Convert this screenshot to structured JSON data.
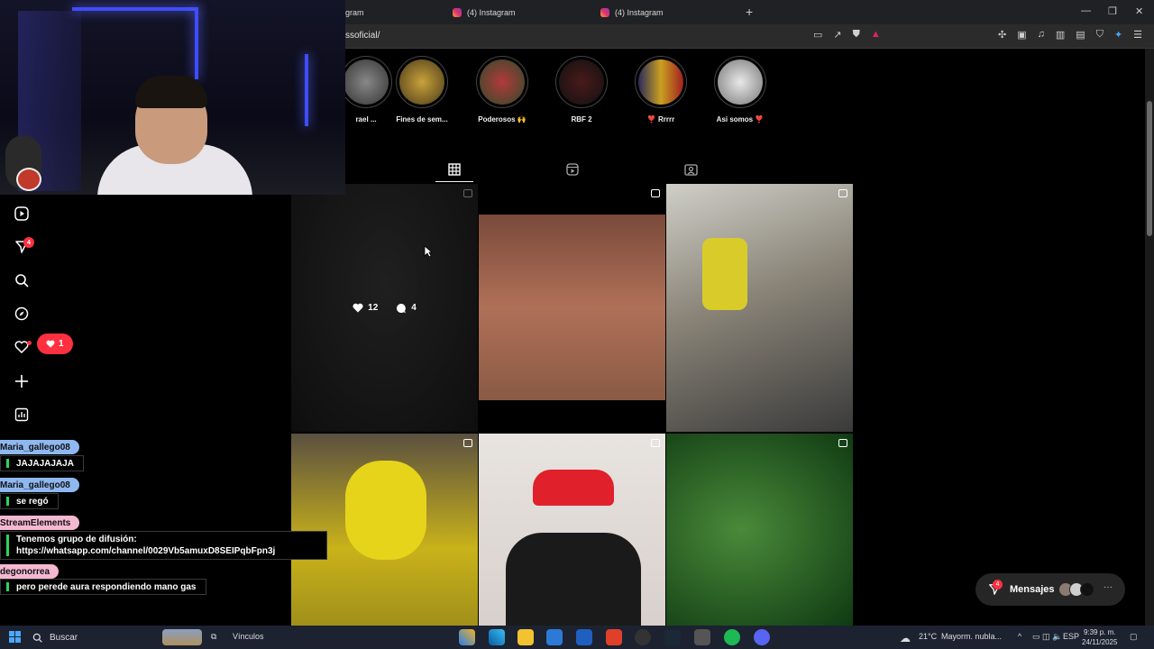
{
  "browser": {
    "tabs": [
      {
        "label": "gram"
      },
      {
        "label": "(4) Instagram"
      },
      {
        "label": "(4) Instagram"
      }
    ],
    "new_tab": "+",
    "url": "ssoficial/",
    "window_controls": [
      "—",
      "❐",
      "✕"
    ]
  },
  "stories": [
    {
      "label": "rael ..."
    },
    {
      "label": "Fines de sem..."
    },
    {
      "label": "Poderosos 🙌"
    },
    {
      "label": "RBF 2"
    },
    {
      "label": "❣️ Rrrrr"
    },
    {
      "label": "Asi somos ❣️"
    }
  ],
  "profile_tabs": [
    "posts-grid-icon",
    "reels-icon",
    "tagged-icon"
  ],
  "sidebar": {
    "icons": [
      "reels-icon",
      "messages-icon",
      "search-icon",
      "explore-icon",
      "notifications-icon",
      "create-icon",
      "dashboard-icon"
    ],
    "messages_badge": "4",
    "notification_count": "1"
  },
  "posts": [
    {
      "likes": "12",
      "comments": "4",
      "hover": true,
      "type": "reel"
    },
    {
      "type": "carousel"
    },
    {
      "type": "carousel"
    },
    {
      "type": "reel"
    },
    {
      "type": "carousel"
    },
    {
      "type": "carousel"
    }
  ],
  "chat": [
    {
      "user": "Maria_gallego08",
      "color": "#8fb8f0",
      "message": "JAJAJAJAJA"
    },
    {
      "user": "Maria_gallego08",
      "color": "#8fb8f0",
      "message": "se regó"
    },
    {
      "user": "StreamElements",
      "color": "#f4b8d0",
      "message": "Tenemos grupo de difusión:",
      "message2": "https://whatsapp.com/channel/0029Vb5amuxD8SEIPqbFpn3j"
    },
    {
      "user": "degonorrea",
      "color": "#f4b8d0",
      "message": "pero perede aura respondiendo mano gas"
    }
  ],
  "messages_pill": {
    "label": "Mensajes",
    "badge": "4",
    "more": "···"
  },
  "taskbar": {
    "search": "Buscar",
    "vinculos": "Vínculos",
    "weather": "21°C",
    "weather_desc": "Mayorm. nubla...",
    "lang": "ESP",
    "time": "9:39 p. m.",
    "date": "24/11/2025"
  }
}
